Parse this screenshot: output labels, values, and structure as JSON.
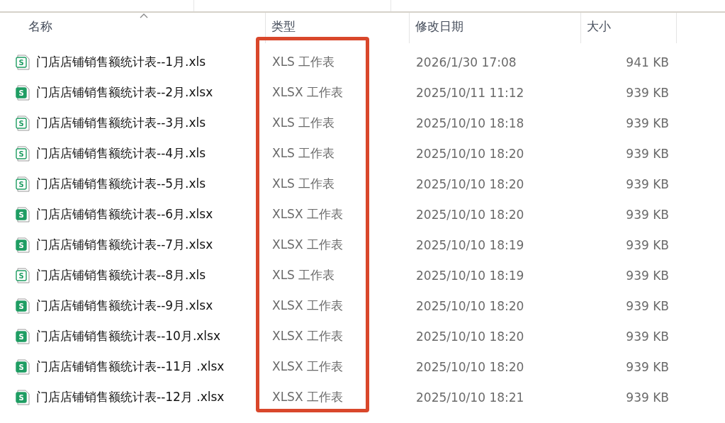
{
  "columns": [
    {
      "label": "名称",
      "sorted": true
    },
    {
      "label": "类型",
      "sorted": false
    },
    {
      "label": "修改日期",
      "sorted": false
    },
    {
      "label": "大小",
      "sorted": false
    }
  ],
  "rows": [
    {
      "kind": "xls",
      "icon_text": "S",
      "name": "门店店铺销售额统计表--1月.xls",
      "type": "XLS 工作表",
      "modified": "2026/1/30 17:08",
      "size": "941 KB"
    },
    {
      "kind": "xlsx",
      "icon_text": "S",
      "name": "门店店铺销售额统计表--2月.xlsx",
      "type": "XLSX 工作表",
      "modified": "2025/10/11 11:12",
      "size": "939 KB"
    },
    {
      "kind": "xls",
      "icon_text": "S",
      "name": "门店店铺销售额统计表--3月.xls",
      "type": "XLS 工作表",
      "modified": "2025/10/10 18:18",
      "size": "939 KB"
    },
    {
      "kind": "xls",
      "icon_text": "S",
      "name": "门店店铺销售额统计表--4月.xls",
      "type": "XLS 工作表",
      "modified": "2025/10/10 18:20",
      "size": "939 KB"
    },
    {
      "kind": "xls",
      "icon_text": "S",
      "name": "门店店铺销售额统计表--5月.xls",
      "type": "XLS 工作表",
      "modified": "2025/10/10 18:20",
      "size": "939 KB"
    },
    {
      "kind": "xlsx",
      "icon_text": "S",
      "name": "门店店铺销售额统计表--6月.xlsx",
      "type": "XLSX 工作表",
      "modified": "2025/10/10 18:20",
      "size": "939 KB"
    },
    {
      "kind": "xlsx",
      "icon_text": "S",
      "name": "门店店铺销售额统计表--7月.xlsx",
      "type": "XLSX 工作表",
      "modified": "2025/10/10 18:19",
      "size": "939 KB"
    },
    {
      "kind": "xls",
      "icon_text": "S",
      "name": "门店店铺销售额统计表--8月.xls",
      "type": "XLS 工作表",
      "modified": "2025/10/10 18:19",
      "size": "939 KB"
    },
    {
      "kind": "xlsx",
      "icon_text": "S",
      "name": "门店店铺销售额统计表--9月.xlsx",
      "type": "XLSX 工作表",
      "modified": "2025/10/10 18:20",
      "size": "939 KB"
    },
    {
      "kind": "xlsx",
      "icon_text": "S",
      "name": "门店店铺销售额统计表--10月.xlsx",
      "type": "XLSX 工作表",
      "modified": "2025/10/10 18:20",
      "size": "939 KB"
    },
    {
      "kind": "xlsx",
      "icon_text": "S",
      "name": "门店店铺销售额统计表--11月 .xlsx",
      "type": "XLSX 工作表",
      "modified": "2025/10/10 18:20",
      "size": "939 KB"
    },
    {
      "kind": "xlsx",
      "icon_text": "S",
      "name": "门店店铺销售额统计表--12月 .xlsx",
      "type": "XLSX 工作表",
      "modified": "2025/10/10 18:21",
      "size": "939 KB"
    }
  ]
}
